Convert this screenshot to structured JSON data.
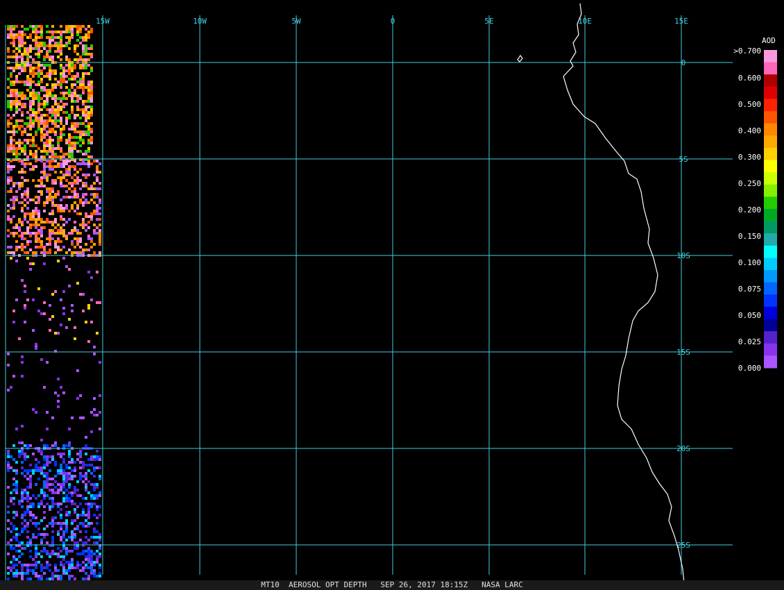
{
  "map": {
    "lon_labels": [
      "15W",
      "10W",
      "5W",
      "0",
      "5E",
      "10E",
      "15E"
    ],
    "lat_labels": [
      "0",
      "5S",
      "10S",
      "15S",
      "20S",
      "25S"
    ],
    "grid_color": "#3fd0e0",
    "coast_color": "#ffffff"
  },
  "legend": {
    "title": "AOD",
    "labels": [
      ">0.700",
      "0.600",
      "0.500",
      "0.400",
      "0.300",
      "0.250",
      "0.200",
      "0.150",
      "0.100",
      "0.075",
      "0.050",
      "0.025",
      "0.000"
    ],
    "colors": [
      "#ff99dd",
      "#ff66bb",
      "#b00000",
      "#e00000",
      "#ff2200",
      "#ff5500",
      "#ff8800",
      "#ffaa00",
      "#ffd000",
      "#ffff00",
      "#ccff00",
      "#88ee00",
      "#22cc00",
      "#00aa22",
      "#009966",
      "#22aaaa",
      "#00ffff",
      "#00ccff",
      "#0099ff",
      "#0066ff",
      "#0033ff",
      "#0000dd",
      "#000099",
      "#5522cc",
      "#8833ee",
      "#aa55ff"
    ]
  },
  "footer": {
    "text": "MT10  AEROSOL OPT DEPTH   SEP 26, 2017 18:15Z   NASA LARC"
  }
}
